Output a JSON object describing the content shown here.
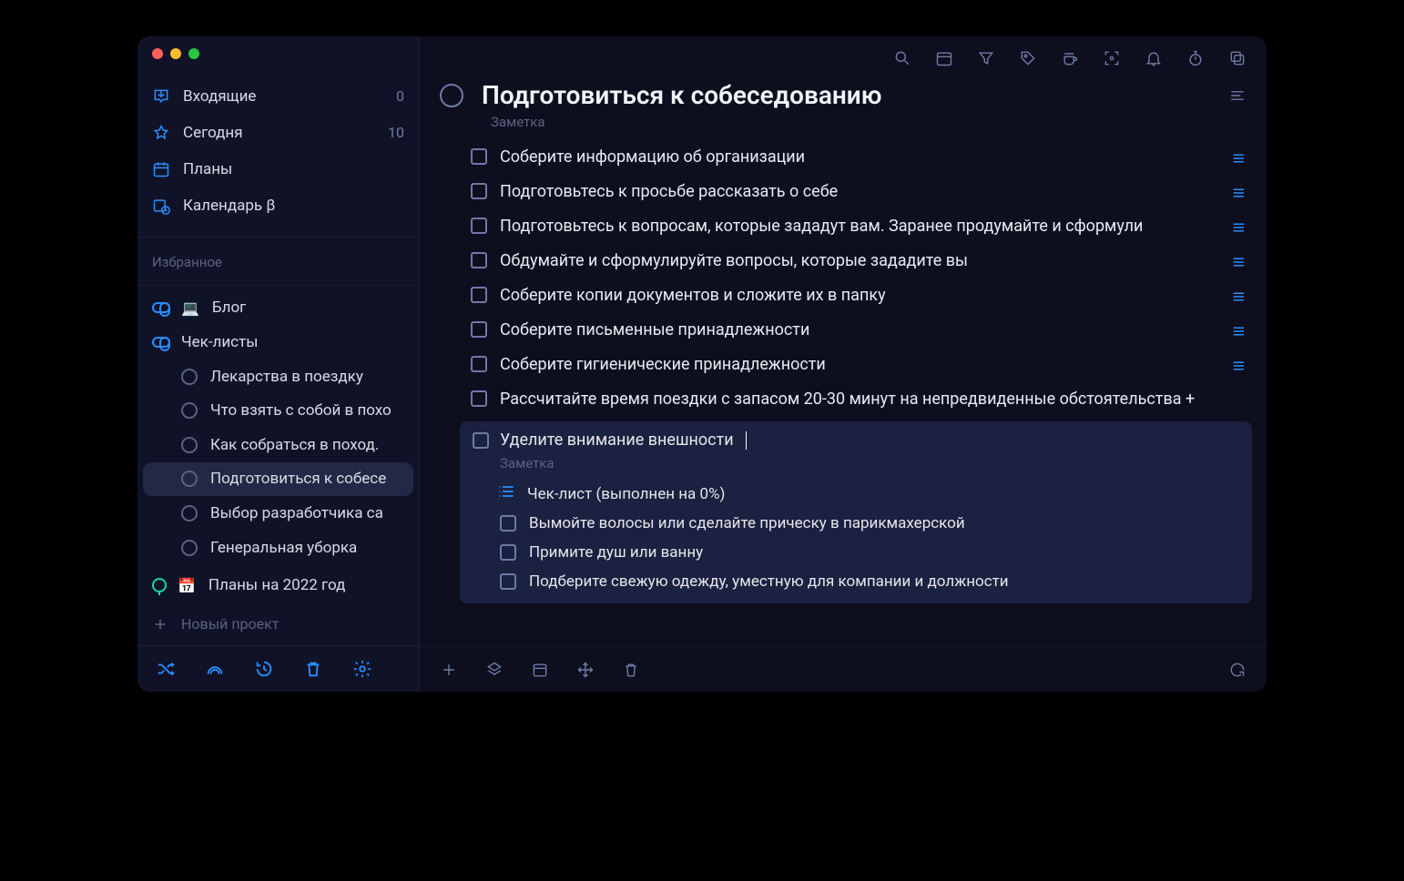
{
  "sidebar": {
    "nav": [
      {
        "label": "Входящие",
        "count": "0"
      },
      {
        "label": "Сегодня",
        "count": "10"
      },
      {
        "label": "Планы",
        "count": ""
      },
      {
        "label": "Календарь β",
        "count": ""
      }
    ],
    "favorites_label": "Избранное",
    "projects": [
      {
        "label": "Блог"
      },
      {
        "label": "Чек-листы"
      }
    ],
    "checklists": [
      {
        "label": "Лекарства в поездку"
      },
      {
        "label": "Что взять с собой в похо"
      },
      {
        "label": "Как собраться в поход."
      },
      {
        "label": "Подготовиться к собесе"
      },
      {
        "label": "Выбор разработчика са"
      },
      {
        "label": "Генеральная уборка"
      }
    ],
    "plans_2022": "Планы на 2022 год",
    "new_project": "Новый проект"
  },
  "main": {
    "title": "Подготовиться к собеседованию",
    "note_placeholder": "Заметка",
    "tasks": [
      "Соберите информацию об организации",
      "Подготовьтесь к просьбе рассказать о себе",
      "Подготовьтесь к вопросам, которые зададут вам. Заранее продумайте и сформули",
      "Обдумайте и сформулируйте вопросы, которые зададите вы",
      "Соберите копии документов и сложите их в папку",
      "Соберите письменные принадлежности",
      "Соберите гигиенические принадлежности",
      "Рассчитайте время поездки с запасом 20-30 минут на непредвиденные обстоятельства +"
    ],
    "tasks_hasList": [
      true,
      true,
      true,
      true,
      true,
      true,
      true,
      false
    ],
    "expanded": {
      "title": "Уделите внимание внешности",
      "note": "Заметка",
      "checklist_header": "Чек-лист (выполнен на 0%)",
      "items": [
        "Вымойте волосы или сделайте прическу в парикмахерской",
        "Примите душ или ванну",
        "Подберите свежую одежду, уместную для компании и должности"
      ]
    }
  },
  "emoji": {
    "laptop": "💻",
    "calendar": "📅"
  }
}
